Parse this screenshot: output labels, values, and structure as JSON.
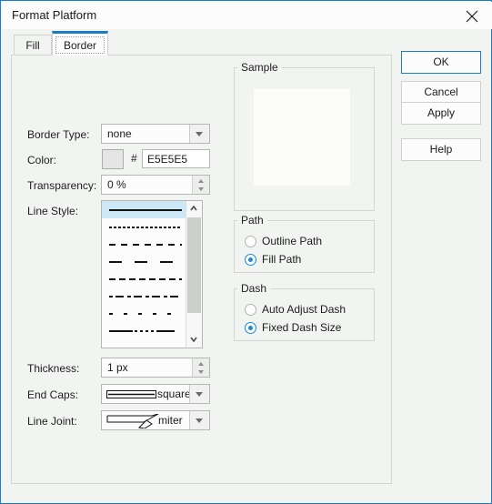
{
  "window": {
    "title": "Format Platform",
    "close_icon": "close-icon"
  },
  "tabs": [
    {
      "label": "Fill",
      "active": false
    },
    {
      "label": "Border",
      "active": true
    }
  ],
  "border_tab": {
    "fields": {
      "border_type_label": "Border Type:",
      "border_type_value": "none",
      "color_label": "Color:",
      "color_swatch_hex": "#E5E5E5",
      "hash": "#",
      "color_value": "E5E5E5",
      "transparency_label": "Transparency:",
      "transparency_value": "0 %",
      "line_style_label": "Line Style:",
      "thickness_label": "Thickness:",
      "thickness_value": "1 px",
      "end_caps_label": "End Caps:",
      "end_caps_value": "square",
      "line_joint_label": "Line Joint:",
      "line_joint_value": "miter"
    },
    "line_styles": [
      {
        "name": "solid",
        "dash": "0",
        "selected": true
      },
      {
        "name": "fine-dotted",
        "dash": "3 2",
        "selected": false
      },
      {
        "name": "dashed",
        "dash": "7 6",
        "selected": false
      },
      {
        "name": "long-dash-spaced",
        "dash": "14 14",
        "selected": false
      },
      {
        "name": "medium-dashed",
        "dash": "7 4",
        "selected": false
      },
      {
        "name": "dash-dot",
        "dash": "4 3 9 4",
        "selected": false
      },
      {
        "name": "sparse-dot",
        "dash": "4 12",
        "selected": false
      },
      {
        "name": "dash-dot-dash",
        "dash": "26 2 3 3 3 3 3 3 3 3 20",
        "selected": false
      }
    ],
    "sample": {
      "legend": "Sample",
      "fill_color": "#FCFDFA"
    },
    "path_group": {
      "legend": "Path",
      "options": [
        {
          "label": "Outline Path",
          "checked": false
        },
        {
          "label": "Fill Path",
          "checked": true
        }
      ]
    },
    "dash_group": {
      "legend": "Dash",
      "options": [
        {
          "label": "Auto Adjust Dash",
          "checked": false
        },
        {
          "label": "Fixed Dash Size",
          "checked": true
        }
      ]
    }
  },
  "buttons": [
    {
      "label": "OK",
      "default": true
    },
    {
      "label": "Cancel",
      "default": false
    },
    {
      "label": "Apply",
      "default": false
    },
    {
      "label": "Help",
      "default": false
    }
  ],
  "colors": {
    "accent": "#1A7CC4",
    "selection": "#CCE8F7",
    "panel": "#F2F4F2"
  }
}
